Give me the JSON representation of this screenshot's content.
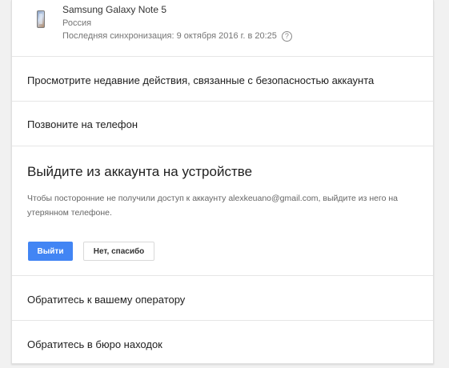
{
  "device": {
    "name": "Samsung Galaxy Note 5",
    "country": "Россия",
    "last_sync": "Последняя синхронизация: 9 октября 2016 г. в 20:25",
    "help_glyph": "?"
  },
  "actions": {
    "review_security": "Просмотрите недавние действия, связанные с безопасностью аккаунта",
    "call_phone": "Позвоните на телефон",
    "contact_operator": "Обратитесь к вашему оператору",
    "lost_and_found": "Обратитесь в бюро находок"
  },
  "sign_out": {
    "title": "Выйдите из аккаунта на устройстве",
    "description": "Чтобы посторонние не получили доступ к аккаунту alexkeuano@gmail.com, выйдите из него на утерянном телефоне.",
    "confirm_label": "Выйти",
    "decline_label": "Нет, спасибо"
  },
  "colors": {
    "primary": "#4285f4",
    "background": "#f1f1f1",
    "card": "#ffffff"
  }
}
